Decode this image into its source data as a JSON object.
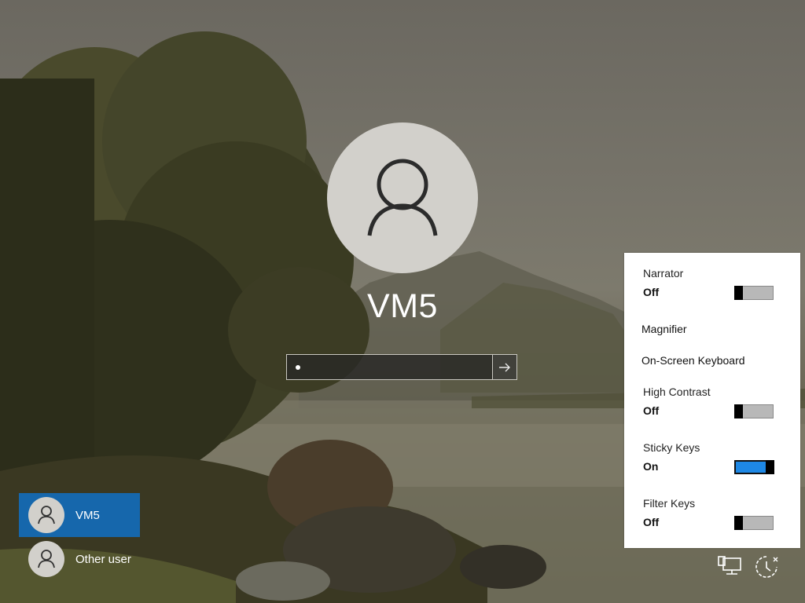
{
  "account": {
    "name": "VM5",
    "password_mask": "•"
  },
  "user_switcher": [
    {
      "name": "VM5",
      "selected": true
    },
    {
      "name": "Other user",
      "selected": false
    }
  ],
  "ease_of_access": {
    "narrator": {
      "label": "Narrator",
      "state": "Off",
      "on": false
    },
    "magnifier": {
      "label": "Magnifier"
    },
    "osk": {
      "label": "On-Screen Keyboard"
    },
    "high_contrast": {
      "label": "High Contrast",
      "state": "Off",
      "on": false
    },
    "sticky_keys": {
      "label": "Sticky Keys",
      "state": "On",
      "on": true
    },
    "filter_keys": {
      "label": "Filter Keys",
      "state": "Off",
      "on": false
    }
  },
  "icons": {
    "network": "network-icon",
    "ease_of_access": "ease-of-access-icon",
    "submit": "arrow-right-icon",
    "user": "user-silhouette-icon"
  },
  "colors": {
    "selected_user": "#1667ac",
    "toggle_on": "#1e88e5"
  }
}
